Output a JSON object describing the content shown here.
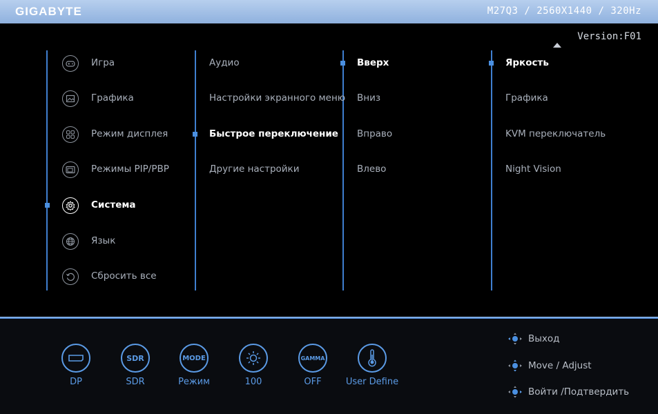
{
  "header": {
    "brand": "GIGABYTE",
    "model_info": "M27Q3  / 2560X1440  / 320Hz"
  },
  "version": "Version:F01",
  "column1": [
    {
      "label": "Игра",
      "icon": "gamepad-icon",
      "selected": false
    },
    {
      "label": "Графика",
      "icon": "picture-icon",
      "selected": false
    },
    {
      "label": "Режим дисплея",
      "icon": "display-grid-icon",
      "selected": false
    },
    {
      "label": "Режимы PIP/PBP",
      "icon": "pip-icon",
      "selected": false
    },
    {
      "label": "Система",
      "icon": "gear-icon",
      "selected": true
    },
    {
      "label": "Язык",
      "icon": "globe-icon",
      "selected": false
    },
    {
      "label": "Сбросить все",
      "icon": "reset-icon",
      "selected": false
    }
  ],
  "column2": [
    {
      "label": "Аудио",
      "selected": false
    },
    {
      "label": "Настройки экранного меню",
      "selected": false
    },
    {
      "label": "Быстрое переключение",
      "selected": true
    },
    {
      "label": "Другие настройки",
      "selected": false
    }
  ],
  "column3": [
    {
      "label": "Вверх",
      "selected": true
    },
    {
      "label": "Вниз",
      "selected": false
    },
    {
      "label": "Вправо",
      "selected": false
    },
    {
      "label": "Влево",
      "selected": false
    }
  ],
  "column4": [
    {
      "label": "Яркость",
      "selected": true
    },
    {
      "label": "Графика",
      "selected": false
    },
    {
      "label": "KVM переключатель",
      "selected": false
    },
    {
      "label": "Night Vision",
      "selected": false
    }
  ],
  "status": {
    "input": {
      "icon_text": "",
      "label": "DP",
      "icon": "displayport-icon"
    },
    "hdr": {
      "icon_text": "SDR",
      "label": "SDR",
      "icon": "sdr-icon"
    },
    "mode": {
      "icon_text": "MODE",
      "label": "Режим",
      "icon": "mode-icon"
    },
    "brightness": {
      "icon_text": "",
      "label": "100",
      "icon": "brightness-icon"
    },
    "gamma": {
      "icon_text": "GAMMA",
      "label": "OFF",
      "icon": "gamma-icon"
    },
    "color_temp": {
      "icon_text": "",
      "label": "User Define",
      "icon": "thermometer-icon"
    }
  },
  "help": {
    "exit": "Выход",
    "move": "Move / Adjust",
    "confirm": "Войти /Подтвердить"
  },
  "colors": {
    "accent": "#4a8fe0",
    "header": "#9fbfe8"
  }
}
